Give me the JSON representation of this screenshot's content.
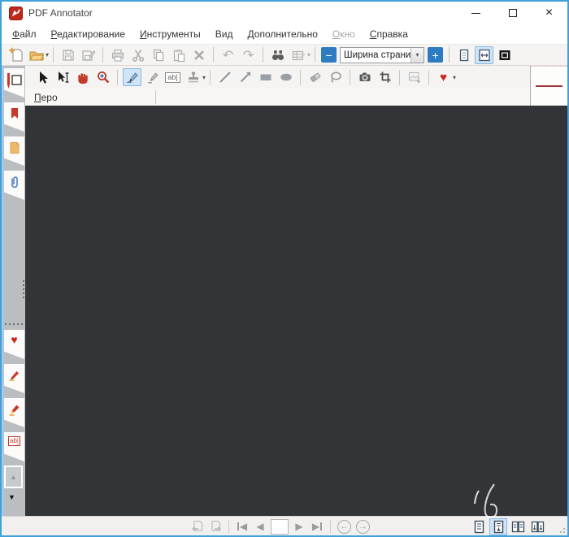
{
  "window": {
    "title": "PDF Annotator"
  },
  "glyphs": {
    "close": "×",
    "caret": "▾",
    "minus": "−",
    "plus": "+",
    "undo": "↶",
    "redo": "↷",
    "heart": "♥",
    "tri_left": "◀",
    "tri_right": "▶",
    "back": "←",
    "forward": "→",
    "up": "▲",
    "down": "▼",
    "text_tool": "ab|"
  },
  "menubar": {
    "items": [
      {
        "label": "Файл",
        "enabled": true
      },
      {
        "label": "Редактирование",
        "enabled": true
      },
      {
        "label": "Инструменты",
        "enabled": true
      },
      {
        "label": "Вид",
        "enabled": true
      },
      {
        "label": "Дополнительно",
        "enabled": true
      },
      {
        "label": "Окно",
        "enabled": false
      },
      {
        "label": "Справка",
        "enabled": true
      }
    ]
  },
  "toolbar_main": {
    "zoom_value": "Ширина страни",
    "icons": [
      "new-document",
      "open-file",
      "save",
      "save-as",
      "print",
      "cut",
      "copy",
      "paste",
      "delete",
      "undo",
      "redo",
      "search",
      "sort-annotations",
      "zoom-out",
      "zoom-level",
      "zoom-in",
      "single-page-view",
      "fit-width-view",
      "fullscreen-view"
    ],
    "enabled_icons": [
      "new-document",
      "open-file",
      "search",
      "zoom-out",
      "zoom-level",
      "zoom-in",
      "single-page-view",
      "fit-width-view",
      "fullscreen-view"
    ],
    "selected_icon": "fit-width-view"
  },
  "toolbar_tools": {
    "icons": [
      "select",
      "select-text",
      "pan-hand",
      "zoom-tool",
      "pen",
      "marker",
      "text",
      "stamp",
      "line",
      "arrow",
      "rectangle",
      "ellipse",
      "eraser",
      "lasso",
      "snapshot",
      "crop",
      "insert-image",
      "favorites"
    ],
    "active_tool": "pen"
  },
  "properties_bar": {
    "tool_label": "Перо"
  },
  "sidebar": {
    "tabs_top": [
      "current-tool",
      "bookmarks",
      "notes",
      "attachments"
    ],
    "tabs_bottom": [
      "favorites",
      "pen",
      "marker",
      "text"
    ],
    "active_tab": "current-tool"
  },
  "bottombar": {
    "page_value": "",
    "nav_icons": [
      "previous-view",
      "next-view",
      "first-page",
      "previous-page",
      "page-number",
      "next-page",
      "last-page",
      "history-back",
      "history-forward"
    ],
    "layout_buttons": [
      "single-page",
      "continuous",
      "facing-pages",
      "continuous-facing"
    ],
    "selected_layout": "continuous"
  },
  "colors": {
    "accent_blue": "#2d7cc1",
    "selection_bg": "#cfe4f7",
    "canvas": "#333438",
    "tool_red": "#c23a2a",
    "window_border": "#41a0dc"
  }
}
